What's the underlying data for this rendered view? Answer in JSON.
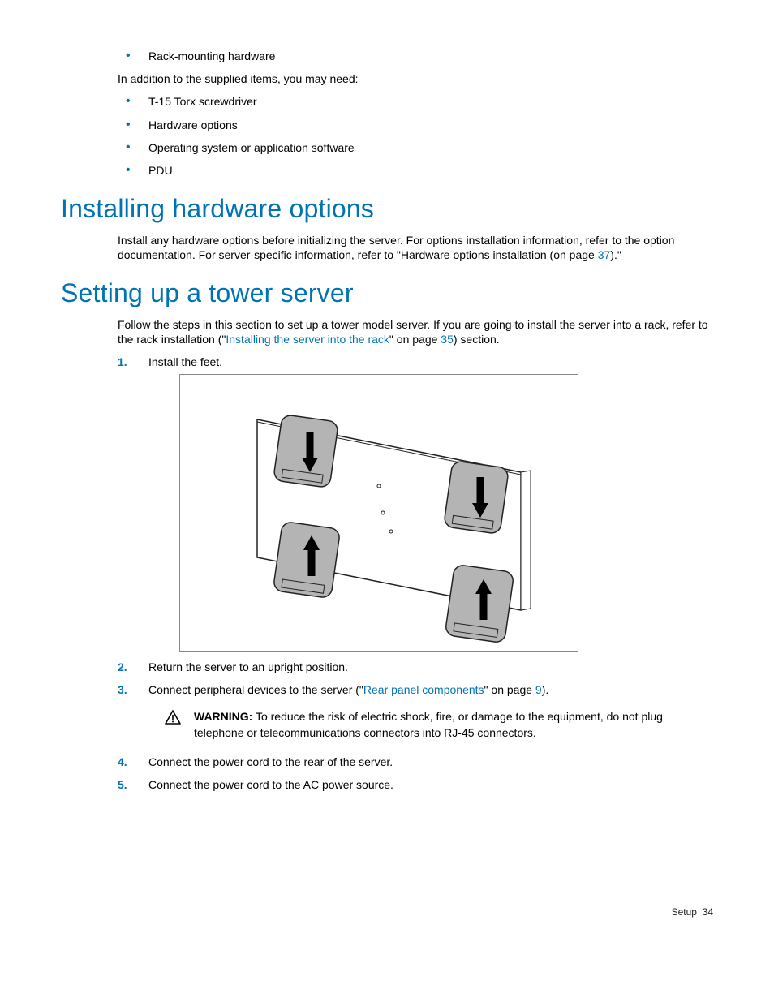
{
  "top_list": {
    "items": [
      "Rack-mounting hardware"
    ],
    "intro": "In addition to the supplied items, you may need:",
    "items2": [
      "T-15 Torx screwdriver",
      "Hardware options",
      "Operating system or application software",
      "PDU"
    ]
  },
  "section1": {
    "heading": "Installing hardware options",
    "body_pre": "Install any hardware options before initializing the server. For options installation information, refer to the option documentation. For server-specific information, refer to \"Hardware options installation (on page ",
    "pgref": "37",
    "body_post": ").\""
  },
  "section2": {
    "heading": "Setting up a tower server",
    "intro_pre": "Follow the steps in this section to set up a tower model server. If you are going to install the server into a rack, refer to the rack installation (\"",
    "intro_link": "Installing the server into the rack",
    "intro_mid": "\" on page ",
    "intro_pg": "35",
    "intro_post": ") section.",
    "steps": {
      "s1": "Install the feet.",
      "s2": "Return the server to an upright position.",
      "s3_pre": "Connect peripheral devices to the server (\"",
      "s3_link": "Rear panel components",
      "s3_mid": "\" on page ",
      "s3_pg": "9",
      "s3_post": ").",
      "s4": "Connect the power cord to the rear of the server.",
      "s5": "Connect the power cord to the AC power source."
    },
    "warning": {
      "label": "WARNING:",
      "text": " To reduce the risk of electric shock, fire, or damage to the equipment, do not plug telephone or telecommunications connectors into RJ-45 connectors."
    }
  },
  "footer": {
    "section": "Setup",
    "page": "34"
  }
}
